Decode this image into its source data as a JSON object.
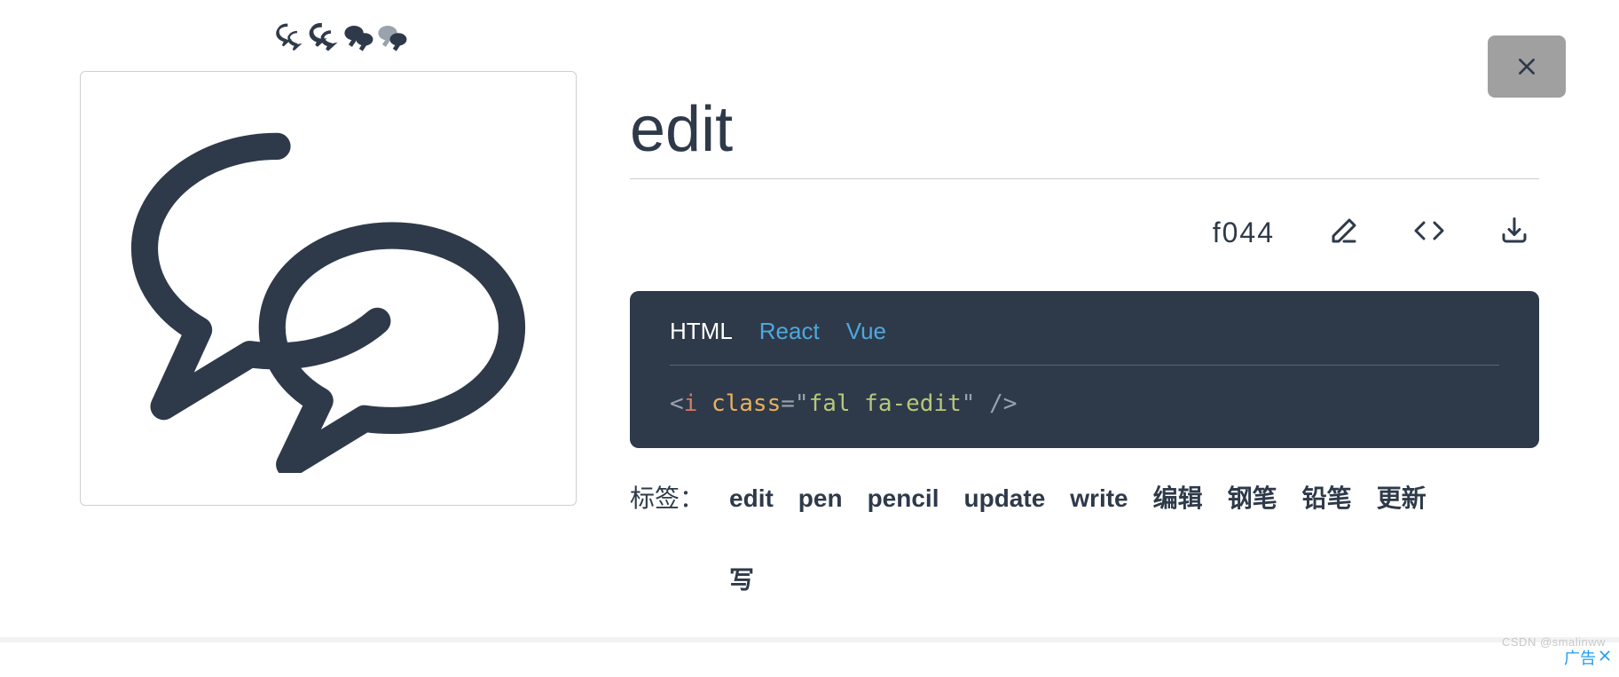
{
  "title": "edit",
  "unicode": "f044",
  "close_label": "×",
  "decor_icons": [
    "comments",
    "comments",
    "comments",
    "comments"
  ],
  "code": {
    "tabs": [
      {
        "label": "HTML",
        "active": true
      },
      {
        "label": "React",
        "active": false
      },
      {
        "label": "Vue",
        "active": false
      }
    ],
    "snippet": {
      "open": "<",
      "tag": "i",
      "space1": " ",
      "attr": "class",
      "eq": "=",
      "q1": "\"",
      "value": "fal fa-edit",
      "q2": "\"",
      "space2": " ",
      "selfclose": "/>"
    }
  },
  "actions": {
    "edit_icon": "edit",
    "code_icon": "code",
    "download_icon": "download"
  },
  "tags_label": "标签：",
  "tags": [
    "edit",
    "pen",
    "pencil",
    "update",
    "write",
    "编辑",
    "钢笔",
    "铅笔",
    "更新",
    "写"
  ],
  "ad_label": "广告",
  "watermark": "CSDN @smalinww"
}
